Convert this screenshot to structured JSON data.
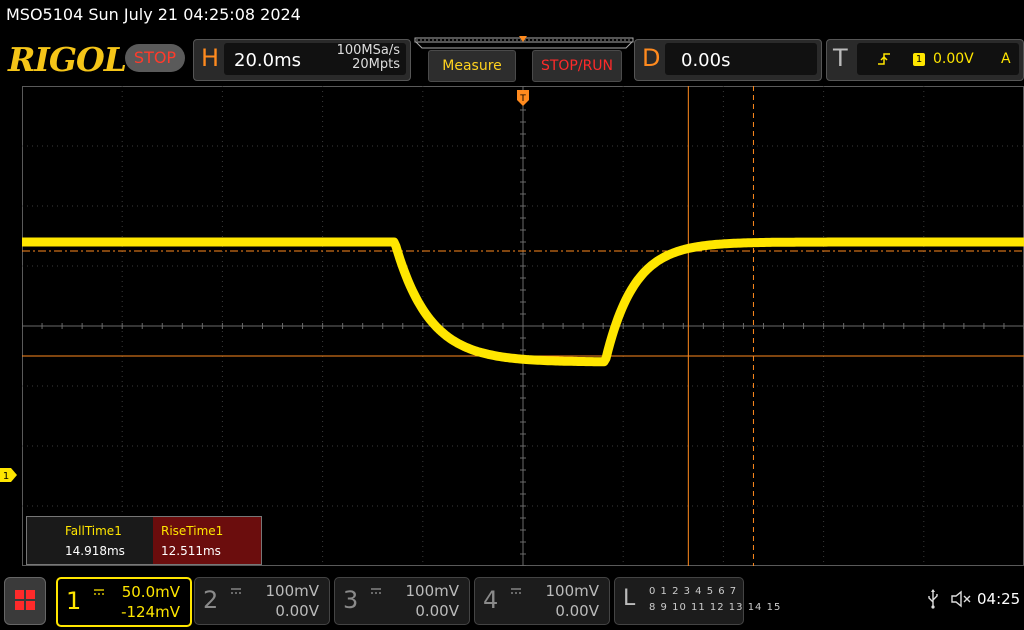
{
  "title": "MSO5104  Sun July 21 04:25:08 2024",
  "brand": {
    "logo": "RIGOL",
    "run_state": "STOP",
    "run_state_color": "#ff3b2b",
    "logo_color": "#f5c518"
  },
  "horizontal": {
    "letter": "H",
    "timebase": "20.0ms",
    "sample_rate": "100MSa/s",
    "mem_depth": "20Mpts"
  },
  "buttons": {
    "measure": "Measure",
    "stop_run": "STOP/RUN"
  },
  "delay": {
    "letter": "D",
    "value": "0.00s"
  },
  "trigger": {
    "letter": "T",
    "edge_icon": "rising-edge-icon",
    "source": "1",
    "level": "0.00V",
    "mode": "A"
  },
  "waveform": {
    "channel": "1",
    "color": "#ffe600",
    "high_level_divs": 1.4,
    "low_level_divs": -0.6,
    "fall_start_ms": -25.6,
    "fall_time_ms": 14.918,
    "rise_start_ms": 16.4,
    "rise_time_ms": 12.511
  },
  "cursors": {
    "color": "#ff8a1e",
    "x_positions_divs": [
      1.65,
      2.3
    ],
    "y_positions_divs": [
      1.25,
      -0.5
    ]
  },
  "measurements": [
    {
      "label": "FallTime1",
      "value": "14.918ms",
      "label_color": "#ffe600",
      "bg": "#1a1a1a"
    },
    {
      "label": "RiseTime1",
      "value": "12.511ms",
      "label_color": "#ffe600",
      "bg": "#6b0d0d"
    }
  ],
  "channels": [
    {
      "num": "1",
      "scale": "50.0mV",
      "offset": "-124mV",
      "color": "#ffe600",
      "active": true
    },
    {
      "num": "2",
      "scale": "100mV",
      "offset": "0.00V",
      "color": "#9a9a9a",
      "active": false
    },
    {
      "num": "3",
      "scale": "100mV",
      "offset": "0.00V",
      "color": "#9a9a9a",
      "active": false
    },
    {
      "num": "4",
      "scale": "100mV",
      "offset": "0.00V",
      "color": "#9a9a9a",
      "active": false
    }
  ],
  "logic": {
    "letter": "L",
    "row1": "0 1 2 3  4 5 6 7",
    "row2": "8 9 10 11 12 13 14 15"
  },
  "status": {
    "time": "04:25"
  }
}
